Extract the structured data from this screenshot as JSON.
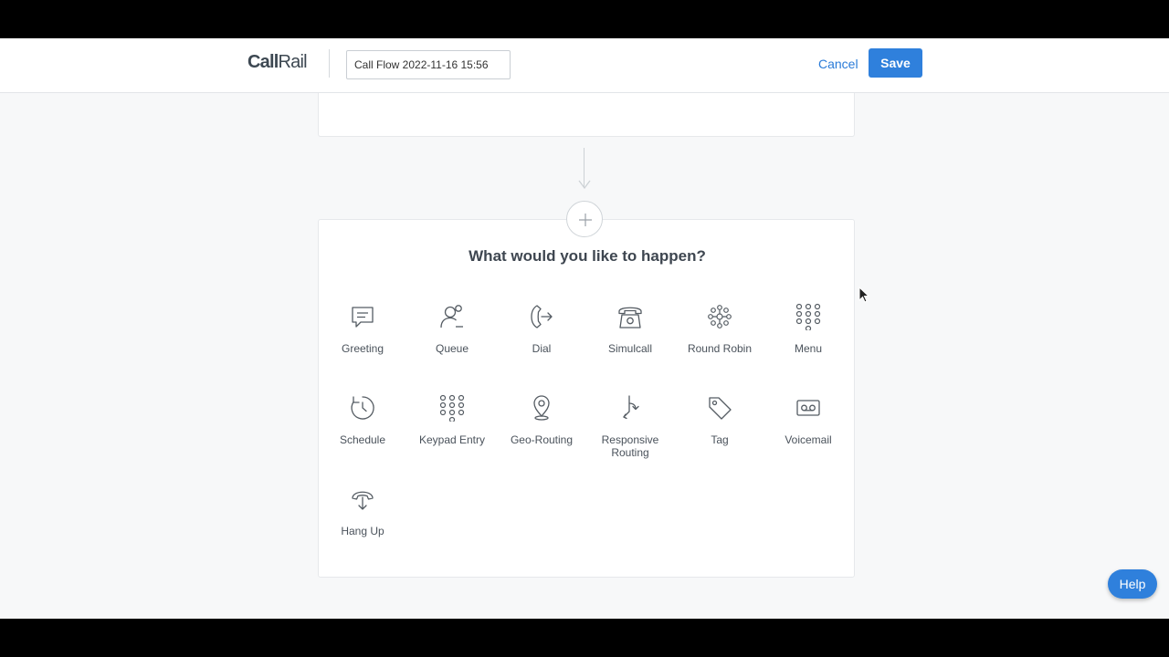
{
  "header": {
    "logo_call": "Call",
    "logo_rail": "Rail",
    "flow_name": "Call Flow 2022-11-16 15:56",
    "cancel_label": "Cancel",
    "save_label": "Save"
  },
  "step_picker": {
    "title": "What would you like to happen?",
    "options": [
      {
        "label": "Greeting",
        "icon": "speech-bubble-icon"
      },
      {
        "label": "Queue",
        "icon": "person-queue-icon"
      },
      {
        "label": "Dial",
        "icon": "phone-forward-icon"
      },
      {
        "label": "Simulcall",
        "icon": "desk-phone-icon"
      },
      {
        "label": "Round Robin",
        "icon": "round-robin-icon"
      },
      {
        "label": "Menu",
        "icon": "keypad-icon"
      },
      {
        "label": "Schedule",
        "icon": "clock-icon"
      },
      {
        "label": "Keypad Entry",
        "icon": "keypad-icon"
      },
      {
        "label": "Geo-Routing",
        "icon": "map-pin-icon"
      },
      {
        "label": "Responsive Routing",
        "icon": "split-arrow-icon"
      },
      {
        "label": "Tag",
        "icon": "tag-icon"
      },
      {
        "label": "Voicemail",
        "icon": "voicemail-icon"
      },
      {
        "label": "Hang Up",
        "icon": "hang-up-icon"
      }
    ]
  },
  "help_label": "Help",
  "colors": {
    "accent": "#2f80dc",
    "icon": "#555c63",
    "background": "#f7f8f9"
  }
}
